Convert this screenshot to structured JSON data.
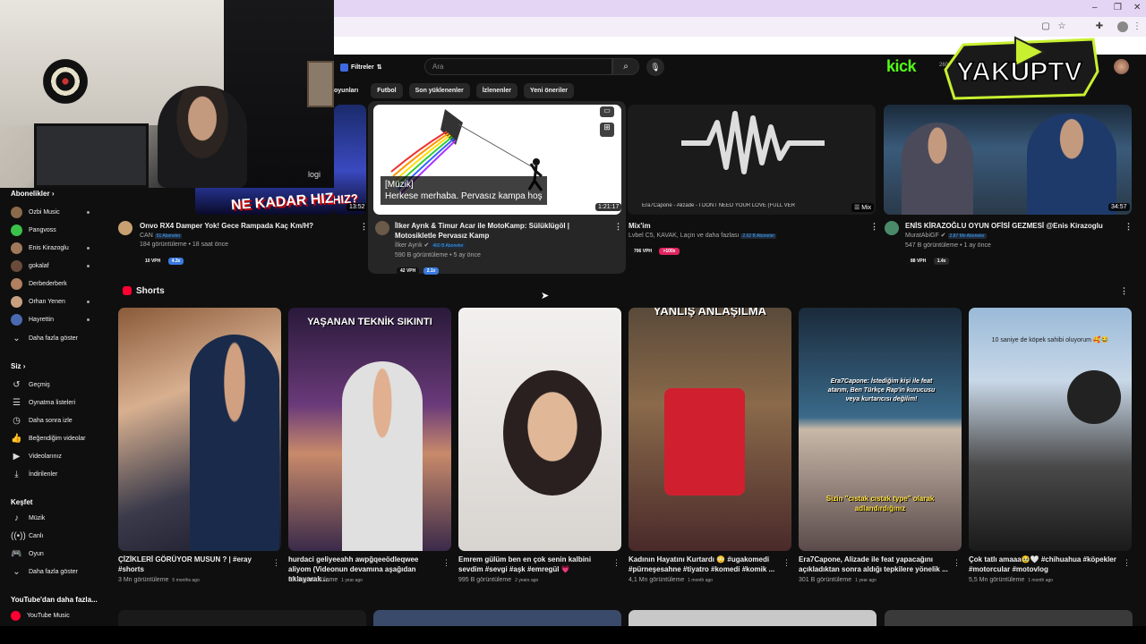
{
  "webcam": {
    "brand_label": "logi"
  },
  "browser": {
    "win_controls": [
      "–",
      "❐",
      "✕"
    ],
    "ext_icons": [
      "square-icon",
      "star-icon",
      "puzzle-icon",
      "profile-icon",
      "menu-icon"
    ]
  },
  "header": {
    "filter_label": "Filtreler",
    "search_placeholder": "Ara",
    "search_icon": "search-icon",
    "mic_icon": "mic-icon",
    "kick_label": "kick",
    "kick_viewers": "260",
    "logo_text": "YAKUPTV"
  },
  "chips": [
    "oyunları",
    "Futbol",
    "Son yüklenenler",
    "İzlenenler",
    "Yeni öneriler"
  ],
  "sidebar": {
    "subscriptions_header": "Abonelikler",
    "subscriptions": [
      {
        "label": "Ozbi Music",
        "color": "#8a6a4a",
        "dot": true
      },
      {
        "label": "Pangvoss",
        "color": "#3ac24a",
        "dot": false
      },
      {
        "label": "Enis Kirazoglu",
        "color": "#a0785a",
        "dot": true
      },
      {
        "label": "gokalaf",
        "color": "#6a4a3a",
        "dot": true
      },
      {
        "label": "Derbederberk",
        "color": "#b08060",
        "dot": false
      },
      {
        "label": "Orhan Yenen",
        "color": "#c8a080",
        "dot": true
      },
      {
        "label": "Hayrettin",
        "color": "#4a6ab0",
        "dot": true
      }
    ],
    "show_more_1": "Daha fazla göster",
    "you_header": "Siz",
    "you_items": [
      {
        "label": "Geçmiş",
        "icon": "history-icon",
        "glyph": "↺"
      },
      {
        "label": "Oynatma listeleri",
        "icon": "playlist-icon",
        "glyph": "☰"
      },
      {
        "label": "Daha sonra izle",
        "icon": "clock-icon",
        "glyph": "◷"
      },
      {
        "label": "Beğendiğim videolar",
        "icon": "thumbs-up-icon",
        "glyph": "👍"
      },
      {
        "label": "Videolarınız",
        "icon": "video-icon",
        "glyph": "▶"
      },
      {
        "label": "İndirilenler",
        "icon": "download-icon",
        "glyph": "⤓"
      }
    ],
    "explore_header": "Keşfet",
    "explore_items": [
      {
        "label": "Müzik",
        "icon": "music-icon",
        "glyph": "♪"
      },
      {
        "label": "Canlı",
        "icon": "live-icon",
        "glyph": "((•))"
      },
      {
        "label": "Oyun",
        "icon": "gamepad-icon",
        "glyph": "🎮"
      }
    ],
    "show_more_2": "Daha fazla göster",
    "more_header": "YouTube'dan daha fazla...",
    "more_items": [
      {
        "label": "YouTube Music",
        "icon": "youtube-music-icon"
      }
    ]
  },
  "videos": [
    {
      "title": "Onvo RX4 Damper Yok! Gece Rampada Kaç Km/H?",
      "channel": "CAN",
      "subs": "51 Aboneler",
      "views": "184 görüntüleme",
      "age": "18 saat önce",
      "vph": "10 VPH",
      "mult": "4.3x",
      "duration": "13:52",
      "thumb_text": "NE KADAR HIZ?"
    },
    {
      "title": "İlker Ayrık & Timur Acar ile MotoKamp: Sülüklügöl | Motosikletle Pervasız Kamp",
      "channel": "İlker Ayrık",
      "subs": "460 B Aboneler",
      "views": "590 B görüntüleme",
      "age": "5 ay önce",
      "vph": "42 VPH",
      "mult": "2.1x",
      "duration": "1:21:17",
      "caption_1": "[Müzik]",
      "caption_2": "Herkese merhaba. Pervasız kampa hoş"
    },
    {
      "title": "Mix'im",
      "channel": "Lvbel C5, KAVAK, Laçin ve daha fazlası",
      "subs": "2.62 B Aboneler",
      "vph": "706 VPH",
      "mult": ">100x",
      "duration": "Mix",
      "thumb_text": "Era7Capone - Alizade - I DONT NEED YOUR LOVE (FULL VER"
    },
    {
      "title": "ENİS KİRAZOĞLU OYUN OFİSİ GEZMESİ @Enis Kirazoglu",
      "channel": "MuratAbiGF",
      "subs": "2.87 Mn Aboneler",
      "views": "547 B görüntüleme",
      "age": "1 ay önce",
      "vph": "88 VPH",
      "mult": "1.4x",
      "duration": "34:57"
    }
  ],
  "shorts_header": "Shorts",
  "shorts": [
    {
      "title": "ÇİZİKLERİ GÖRÜYOR MUSUN ? | #eray #shorts",
      "views": "3 Mn görüntüleme",
      "ago": "5 months ago",
      "overlay": ""
    },
    {
      "title": "hurdaci geliyeeahh awpğqeeödleqwee aliyom (Videonun devamına aşağıdan tıklayarak ...",
      "views": "87 B görüntüleme",
      "ago": "1 year ago",
      "overlay": "YAŞANAN TEKNİK SIKINTI"
    },
    {
      "title": "Emrem gülüm ben en çok senin kalbini sevdim #sevgi #aşk #emregül 💗",
      "views": "995 B görüntüleme",
      "ago": "2 years ago",
      "overlay": ""
    },
    {
      "title": "Kadının Hayatını Kurtardı 😳 #ugakomedi #pürneşesahne #tiyatro #komedi #komik ...",
      "views": "4,1 Mn görüntüleme",
      "ago": "1 month ago",
      "overlay": "YANLIŞ ANLAŞILMA"
    },
    {
      "title": "Era7Capone, Alizade ile feat yapacağını açıkladıktan sonra aldığı tepkilere yönelik ...",
      "views": "301 B görüntüleme",
      "ago": "1 year ago",
      "overlay": "Era7Capone: İstediğim kişi ile feat atarım, Ben Türkçe Rap'in kurucusu veya kurtarıcısı değilim!",
      "overlay_2": "Sizin \"cıstak cıstak type\" olarak adlandırdığınız"
    },
    {
      "title": "Çok tatlı amaaa🥹🤍 #chihuahua #köpekler #motorcular #motovlog",
      "views": "5,5 Mn görüntüleme",
      "ago": "1 month ago",
      "overlay": "10 saniye de köpek sahibi oluyorum 🥰😂"
    }
  ]
}
